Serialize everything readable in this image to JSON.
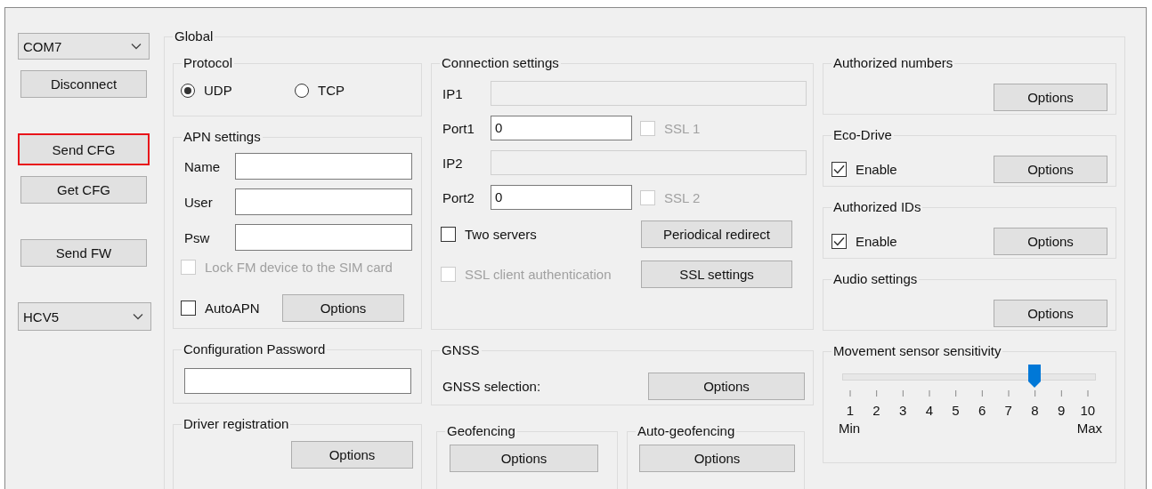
{
  "sidebar": {
    "connection": {
      "port_select": "COM7",
      "buttons": [
        {
          "label": "Disconnect",
          "highlighted": false
        }
      ]
    },
    "config": {
      "buttons": [
        {
          "label": "Send CFG",
          "highlighted": true
        },
        {
          "label": "Get CFG",
          "highlighted": false
        }
      ]
    },
    "firmware": {
      "buttons": [
        {
          "label": "Send FW",
          "highlighted": false
        }
      ]
    },
    "device_select": "HCV5"
  },
  "global": {
    "title": "Global",
    "protocol": {
      "title": "Protocol",
      "options": [
        {
          "label": "UDP",
          "selected": true
        },
        {
          "label": "TCP",
          "selected": false
        }
      ]
    },
    "apn": {
      "title": "APN settings",
      "fields": [
        {
          "label": "Name"
        },
        {
          "label": "User"
        },
        {
          "label": "Psw"
        }
      ],
      "lock_sim": {
        "label": "Lock FM device to the SIM card",
        "checked": false,
        "disabled": true
      },
      "auto_apn": {
        "label": "AutoAPN",
        "checked": false,
        "disabled": false
      },
      "button": "Options"
    },
    "config_password": {
      "title": "Configuration Password"
    },
    "driver_registration": {
      "title": "Driver registration",
      "button": "Options"
    },
    "connection": {
      "title": "Connection settings",
      "rows": [
        {
          "label": "IP1",
          "kind": "ip",
          "disabled": true
        },
        {
          "label": "Port1",
          "kind": "port",
          "value": "0",
          "disabled": false,
          "ssl": {
            "label": "SSL 1",
            "checked": false,
            "disabled": true
          }
        },
        {
          "label": "IP2",
          "kind": "ip",
          "disabled": true
        },
        {
          "label": "Port2",
          "kind": "port",
          "value": "0",
          "disabled": false,
          "ssl": {
            "label": "SSL 2",
            "checked": false,
            "disabled": true
          }
        }
      ],
      "two_servers": {
        "label": "Two servers",
        "checked": false,
        "disabled": false
      },
      "redirect_button": "Periodical redirect",
      "ssl_client": {
        "label": "SSL client authentication",
        "checked": false,
        "disabled": true
      },
      "ssl_button": "SSL settings"
    },
    "gnss": {
      "title": "GNSS",
      "label": "GNSS selection:",
      "button": "Options"
    },
    "geofencing": {
      "title": "Geofencing",
      "button": "Options"
    },
    "auto_geofencing": {
      "title": "Auto-geofencing",
      "button": "Options"
    },
    "right_groups": [
      {
        "title": "Authorized numbers",
        "button": "Options"
      },
      {
        "title": "Eco-Drive",
        "enable": {
          "label": "Enable",
          "checked": true,
          "disabled": false
        },
        "button": "Options"
      },
      {
        "title": "Authorized IDs",
        "enable": {
          "label": "Enable",
          "checked": true,
          "disabled": false
        },
        "button": "Options"
      },
      {
        "title": "Audio settings",
        "button": "Options"
      }
    ],
    "movement_sensor": {
      "title": "Movement sensor sensitivity",
      "level": 0.778,
      "ticks": [
        "1",
        "2",
        "3",
        "4",
        "5",
        "6",
        "7",
        "8",
        "9",
        "10"
      ],
      "min_label": "Min",
      "max_label": "Max"
    }
  }
}
